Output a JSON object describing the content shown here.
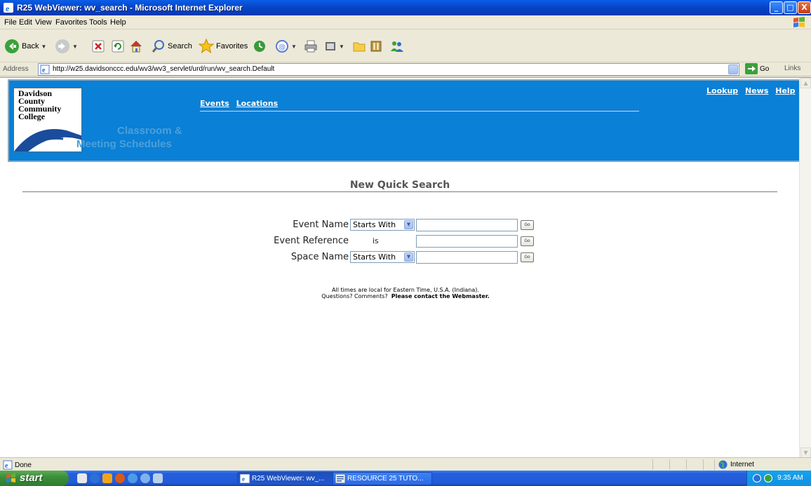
{
  "window": {
    "title": "R25 WebViewer: wv_search - Microsoft Internet Explorer",
    "buttons": {
      "minimize": "_",
      "maximize": "□",
      "close": "X"
    }
  },
  "menu": [
    "File",
    "Edit",
    "View",
    "Favorites",
    "Tools",
    "Help"
  ],
  "toolbar": {
    "back_label": "Back",
    "search_label": "Search",
    "favorites_label": "Favorites"
  },
  "address": {
    "label": "Address",
    "url": "http://w25.davidsonccc.edu/wv3/wv3_servlet/urd/run/wv_search.Default",
    "go_label": "Go",
    "links_label": "Links"
  },
  "page": {
    "logo_lines": [
      "Davidson",
      "County",
      "Community",
      "College"
    ],
    "subtitle_line1": "Classroom &",
    "subtitle_line2": "Meeting Schedules",
    "nav": [
      "Events",
      "Locations"
    ],
    "top_links": [
      "Lookup",
      "News",
      "Help"
    ],
    "heading": "New Quick Search",
    "rows": [
      {
        "label": "Event Name",
        "operator": "Starts With",
        "value": "",
        "go": "Go"
      },
      {
        "label": "Event Reference",
        "operator": "is",
        "value": "",
        "go": "Go"
      },
      {
        "label": "Space Name",
        "operator": "Starts With",
        "value": "",
        "go": "Go"
      }
    ],
    "note_line1": "All times are local for Eastern Time, U.S.A. (Indiana).",
    "note_line2_prefix": "Questions? Comments?",
    "note_line2_link": "Please contact the Webmaster",
    "note_line2_suffix": "."
  },
  "status": {
    "text": "Done",
    "zone": "Internet"
  },
  "taskbar": {
    "start_label": "start",
    "tasks": [
      "R25 WebViewer: wv_...",
      "RESOURCE 25 TUTO..."
    ],
    "clock": "9:35 AM"
  },
  "colors": {
    "banner_blue": "#0a80d6",
    "subtitle_blue": "#4ca0d8",
    "xp_title_blue": "#0845c8",
    "taskbar_blue": "#245edc",
    "start_green": "#3c8f3b"
  }
}
